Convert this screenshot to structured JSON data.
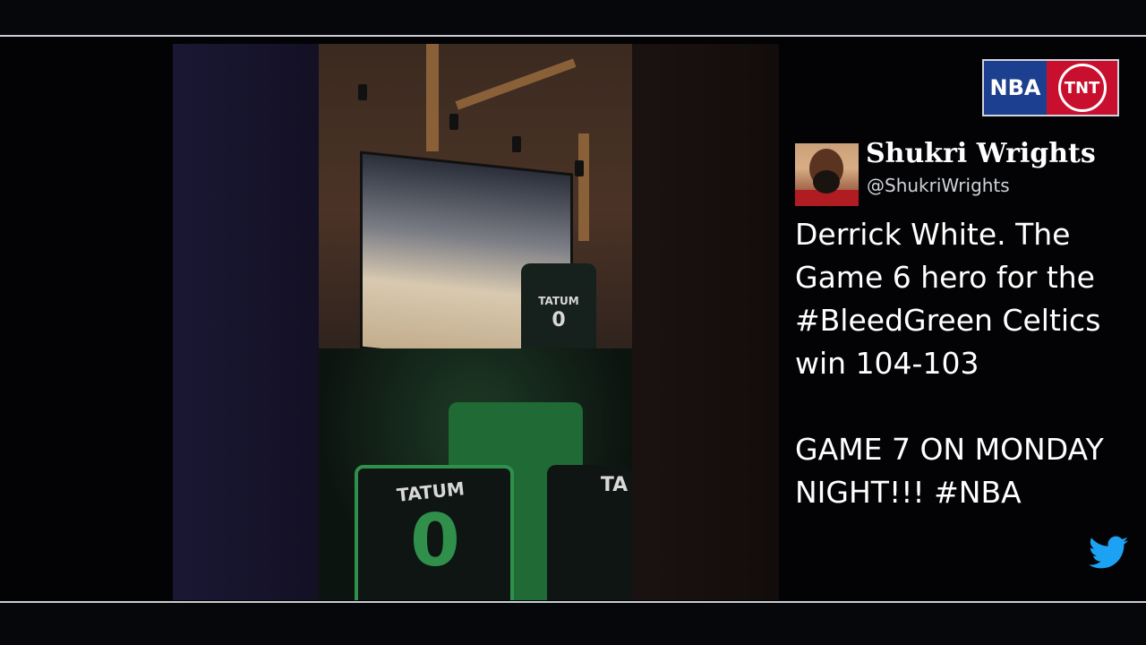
{
  "broadcast": {
    "logo_nba": "NBA",
    "logo_tnt": "TNT"
  },
  "video": {
    "jersey_front_name": "TATUM",
    "jersey_front_number": "0",
    "jersey_back_name": "TATUM",
    "jersey_back_number": "0",
    "jersey_side_name": "TA"
  },
  "tweet": {
    "name": "Shukri Wrights",
    "handle": "@ShukriWrights",
    "text": "Derrick White. The Game 6 hero for the #BleedGreen Celtics win 104-103\n\nGAME 7 ON MONDAY NIGHT!!! #NBA",
    "icon": "twitter-bird-icon",
    "icon_color": "#1da1f2"
  },
  "colors": {
    "celtics_green": "#2f8f4b",
    "nba_blue": "#1d3f8f",
    "tnt_red": "#c8102e"
  }
}
